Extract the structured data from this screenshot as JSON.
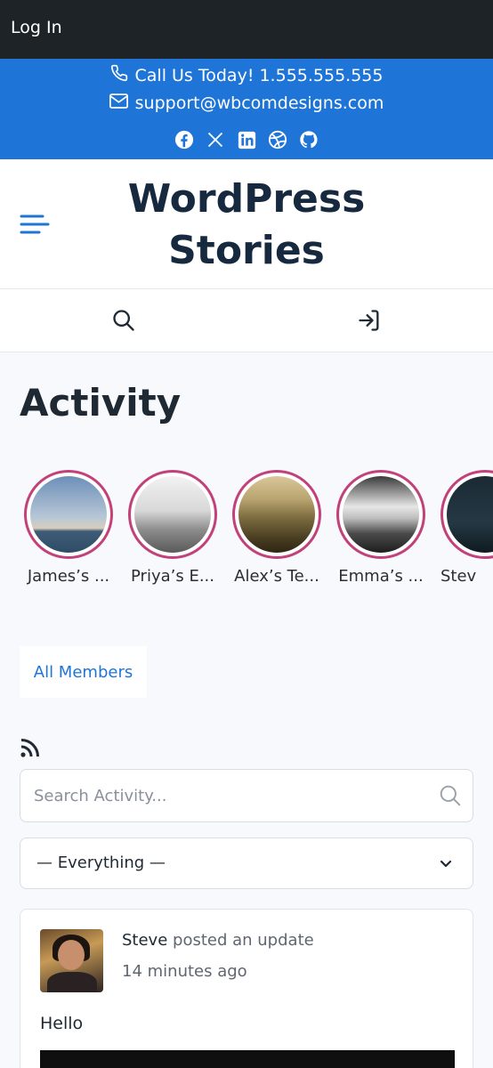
{
  "admin_bar": {
    "login_label": "Log In"
  },
  "top_bar": {
    "phone_text": "Call Us Today! 1.555.555.555",
    "email_text": "support@wbcomdesigns.com",
    "social_icons": [
      "facebook-icon",
      "x-icon",
      "linkedin-icon",
      "dribbble-icon",
      "github-icon"
    ]
  },
  "site": {
    "title_line1": "WordPress",
    "title_line2": "Stories"
  },
  "page": {
    "title": "Activity"
  },
  "stories": [
    {
      "name": "James’s ..."
    },
    {
      "name": "Priya’s E..."
    },
    {
      "name": "Alex’s Te..."
    },
    {
      "name": "Emma’s ..."
    },
    {
      "name": "Stev"
    }
  ],
  "tabs": {
    "all_members": "All Members"
  },
  "search": {
    "placeholder": "Search Activity..."
  },
  "filter": {
    "selected": "— Everything —"
  },
  "activity": [
    {
      "user": "Steve",
      "action": " posted an update",
      "time": "14 minutes ago",
      "content": "Hello"
    }
  ],
  "colors": {
    "accent": "#1f74d8",
    "admin_bar": "#1d2327",
    "story_ring": "#c2417a",
    "title": "#17293f"
  }
}
